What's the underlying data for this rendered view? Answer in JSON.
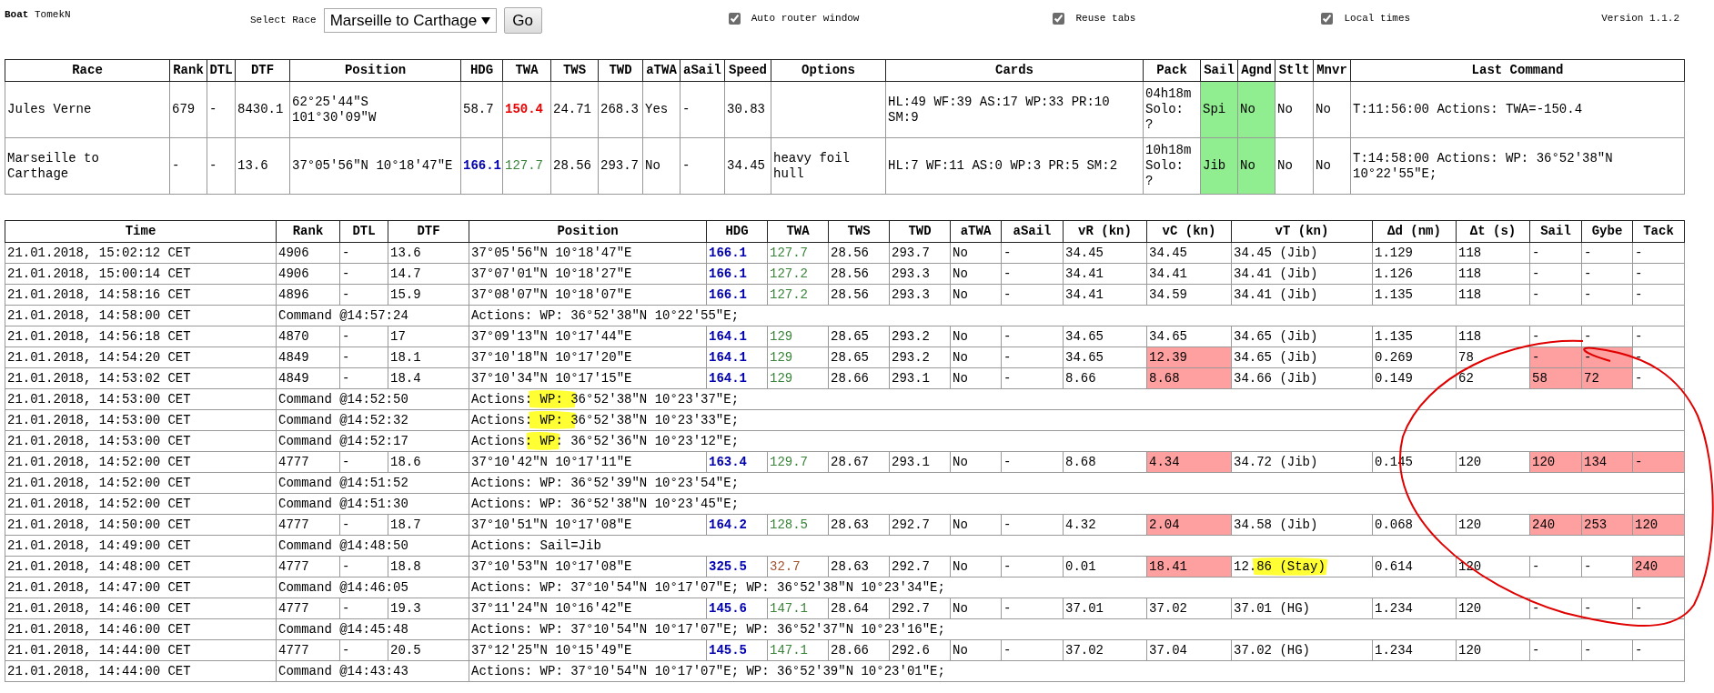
{
  "header": {
    "boat_label": "Boat",
    "boat_name": "TomekN",
    "race_select": {
      "label": "Select Race",
      "value": "Marseille to Carthage"
    },
    "go_button": "Go",
    "options": [
      {
        "label": "Auto router window",
        "checked": true
      },
      {
        "label": "Reuse tabs",
        "checked": true
      },
      {
        "label": "Local times",
        "checked": true
      }
    ],
    "version": "Version 1.1.2"
  },
  "races_columns": [
    "Race",
    "Rank",
    "DTL",
    "DTF",
    "Position",
    "HDG",
    "TWA",
    "TWS",
    "TWD",
    "aTWA",
    "aSail",
    "Speed",
    "Options",
    "Cards",
    "Pack",
    "Sail",
    "Agnd",
    "Stlt",
    "Mnvr",
    "Last Command"
  ],
  "races": [
    {
      "race": "Jules Verne",
      "rank": "679",
      "dtl": "-",
      "dtf": "8430.1",
      "position": "62°25'44\"S 101°30'09\"W",
      "hdg": {
        "text": "58.7",
        "color": "#000000",
        "bold": false
      },
      "twa": {
        "text": "150.4",
        "color": "#ee0000",
        "bold": true
      },
      "tws": "24.71",
      "twd": "268.3",
      "atwa": "Yes",
      "asail": "-",
      "speed": "30.83",
      "cards": "HL:49 WF:39 AS:17 WP:33 PR:10 SM:9",
      "pack": "04h18m Solo: ?",
      "sail": {
        "text": "Spi",
        "highlight": true
      },
      "agnd": {
        "text": "No",
        "highlight": true
      },
      "stlt": "No",
      "mnvr": "No",
      "last_command": "T:11:56:00 Actions: TWA=-150.4"
    },
    {
      "race": "Marseille to Carthage",
      "rank": "-",
      "dtl": "-",
      "dtf": "13.6",
      "position": "37°05'56\"N 10°18'47\"E",
      "hdg": {
        "text": "166.1",
        "color": "#0000b0",
        "bold": true
      },
      "twa": {
        "text": "127.7",
        "color": "#398439",
        "bold": false
      },
      "tws": "28.56",
      "twd": "293.7",
      "atwa": "No",
      "asail": "-",
      "speed": "34.45",
      "options": "heavy foil hull",
      "cards": "HL:7 WF:11 AS:0 WP:3 PR:5 SM:2",
      "pack": "10h18m Solo: ?",
      "sail": {
        "text": "Jib",
        "highlight": true
      },
      "agnd": {
        "text": "No",
        "highlight": true
      },
      "stlt": "No",
      "mnvr": "No",
      "last_command": "T:14:58:00 Actions: WP: 36°52'38\"N 10°22'55\"E;"
    }
  ],
  "log_columns": [
    "Time",
    "Rank",
    "DTL",
    "DTF",
    "Position",
    "HDG",
    "TWA",
    "TWS",
    "TWD",
    "aTWA",
    "aSail",
    "vR (kn)",
    "vC (kn)",
    "vT (kn)",
    "Δd (nm)",
    "Δt (s)",
    "Sail",
    "Gybe",
    "Tack"
  ],
  "log": [
    {
      "kind": "data",
      "time": "21.01.2018, 15:02:12 CET",
      "rank": "4906",
      "dtl": "-",
      "dtf": "13.6",
      "position": "37°05'56\"N 10°18'47\"E",
      "hdg": "166.1",
      "twa": {
        "text": "127.7",
        "color": "#398439"
      },
      "tws": "28.56",
      "twd": "293.7",
      "atwa": "No",
      "asail": "-",
      "vr": "34.45",
      "vc": {
        "text": "34.45",
        "alert": false
      },
      "vt": "34.45 (Jib)",
      "dd": "1.129",
      "dt": "118",
      "sail": {
        "text": "-",
        "alert": false
      },
      "gybe": {
        "text": "-",
        "alert": false
      },
      "tack": {
        "text": "-",
        "alert": false
      }
    },
    {
      "kind": "data",
      "time": "21.01.2018, 15:00:14 CET",
      "rank": "4906",
      "dtl": "-",
      "dtf": "14.7",
      "position": "37°07'01\"N 10°18'27\"E",
      "hdg": "166.1",
      "twa": {
        "text": "127.2",
        "color": "#398439"
      },
      "tws": "28.56",
      "twd": "293.3",
      "atwa": "No",
      "asail": "-",
      "vr": "34.41",
      "vc": {
        "text": "34.41",
        "alert": false
      },
      "vt": "34.41 (Jib)",
      "dd": "1.126",
      "dt": "118",
      "sail": {
        "text": "-",
        "alert": false
      },
      "gybe": {
        "text": "-",
        "alert": false
      },
      "tack": {
        "text": "-",
        "alert": false
      }
    },
    {
      "kind": "data",
      "time": "21.01.2018, 14:58:16 CET",
      "rank": "4896",
      "dtl": "-",
      "dtf": "15.9",
      "position": "37°08'07\"N 10°18'07\"E",
      "hdg": "166.1",
      "twa": {
        "text": "127.2",
        "color": "#398439"
      },
      "tws": "28.56",
      "twd": "293.3",
      "atwa": "No",
      "asail": "-",
      "vr": "34.41",
      "vc": {
        "text": "34.59",
        "alert": false
      },
      "vt": "34.41 (Jib)",
      "dd": "1.135",
      "dt": "118",
      "sail": {
        "text": "-",
        "alert": false
      },
      "gybe": {
        "text": "-",
        "alert": false
      },
      "tack": {
        "text": "-",
        "alert": false
      }
    },
    {
      "kind": "command",
      "time": "21.01.2018, 14:58:00 CET",
      "command": "Command @14:57:24",
      "actions": "Actions: WP: 36°52'38\"N 10°22'55\"E;"
    },
    {
      "kind": "data",
      "time": "21.01.2018, 14:56:18 CET",
      "rank": "4870",
      "dtl": "-",
      "dtf": "17",
      "position": "37°09'13\"N 10°17'44\"E",
      "hdg": "164.1",
      "twa": {
        "text": "129",
        "color": "#398439"
      },
      "tws": "28.65",
      "twd": "293.2",
      "atwa": "No",
      "asail": "-",
      "vr": "34.65",
      "vc": {
        "text": "34.65",
        "alert": false
      },
      "vt": "34.65 (Jib)",
      "dd": "1.135",
      "dt": "118",
      "sail": {
        "text": "-",
        "alert": false
      },
      "gybe": {
        "text": "-",
        "alert": false
      },
      "tack": {
        "text": "-",
        "alert": false
      }
    },
    {
      "kind": "data",
      "time": "21.01.2018, 14:54:20 CET",
      "rank": "4849",
      "dtl": "-",
      "dtf": "18.1",
      "position": "37°10'18\"N 10°17'20\"E",
      "hdg": "164.1",
      "twa": {
        "text": "129",
        "color": "#398439"
      },
      "tws": "28.65",
      "twd": "293.2",
      "atwa": "No",
      "asail": "-",
      "vr": "34.65",
      "vc": {
        "text": "12.39",
        "alert": true
      },
      "vt": "34.65 (Jib)",
      "dd": "0.269",
      "dt": "78",
      "sail": {
        "text": "-",
        "alert": true
      },
      "gybe": {
        "text": "-",
        "alert": true
      },
      "tack": {
        "text": "-",
        "alert": false
      }
    },
    {
      "kind": "data",
      "time": "21.01.2018, 14:53:02 CET",
      "rank": "4849",
      "dtl": "-",
      "dtf": "18.4",
      "position": "37°10'34\"N 10°17'15\"E",
      "hdg": "164.1",
      "twa": {
        "text": "129",
        "color": "#398439"
      },
      "tws": "28.66",
      "twd": "293.1",
      "atwa": "No",
      "asail": "-",
      "vr": "8.66",
      "vc": {
        "text": "8.68",
        "alert": true
      },
      "vt": "34.66 (Jib)",
      "dd": "0.149",
      "dt": "62",
      "sail": {
        "text": "58",
        "alert": true
      },
      "gybe": {
        "text": "72",
        "alert": true
      },
      "tack": {
        "text": "-",
        "alert": false
      }
    },
    {
      "kind": "command",
      "time": "21.01.2018, 14:53:00 CET",
      "command": "Command @14:52:50",
      "actions": "Actions: WP: 36°52'38\"N 10°23'37\"E;"
    },
    {
      "kind": "command",
      "time": "21.01.2018, 14:53:00 CET",
      "command": "Command @14:52:32",
      "actions": "Actions: WP: 36°52'38\"N 10°23'33\"E;"
    },
    {
      "kind": "command",
      "time": "21.01.2018, 14:53:00 CET",
      "command": "Command @14:52:17",
      "actions": "Actions: WP: 36°52'36\"N 10°23'12\"E;"
    },
    {
      "kind": "data",
      "time": "21.01.2018, 14:52:00 CET",
      "rank": "4777",
      "dtl": "-",
      "dtf": "18.6",
      "position": "37°10'42\"N 10°17'11\"E",
      "hdg": "163.4",
      "twa": {
        "text": "129.7",
        "color": "#398439"
      },
      "tws": "28.67",
      "twd": "293.1",
      "atwa": "No",
      "asail": "-",
      "vr": "8.68",
      "vc": {
        "text": "4.34",
        "alert": true
      },
      "vt": "34.72 (Jib)",
      "dd": "0.145",
      "dt": "120",
      "sail": {
        "text": "120",
        "alert": true
      },
      "gybe": {
        "text": "134",
        "alert": true
      },
      "tack": {
        "text": "-",
        "alert": true
      }
    },
    {
      "kind": "command",
      "time": "21.01.2018, 14:52:00 CET",
      "command": "Command @14:51:52",
      "actions": "Actions: WP: 36°52'39\"N 10°23'54\"E;"
    },
    {
      "kind": "command",
      "time": "21.01.2018, 14:52:00 CET",
      "command": "Command @14:51:30",
      "actions": "Actions: WP: 36°52'38\"N 10°23'45\"E;"
    },
    {
      "kind": "data",
      "time": "21.01.2018, 14:50:00 CET",
      "rank": "4777",
      "dtl": "-",
      "dtf": "18.7",
      "position": "37°10'51\"N 10°17'08\"E",
      "hdg": "164.2",
      "twa": {
        "text": "128.5",
        "color": "#398439"
      },
      "tws": "28.63",
      "twd": "292.7",
      "atwa": "No",
      "asail": "-",
      "vr": "4.32",
      "vc": {
        "text": "2.04",
        "alert": true
      },
      "vt": "34.58 (Jib)",
      "dd": "0.068",
      "dt": "120",
      "sail": {
        "text": "240",
        "alert": true
      },
      "gybe": {
        "text": "253",
        "alert": true
      },
      "tack": {
        "text": "120",
        "alert": true
      }
    },
    {
      "kind": "command",
      "time": "21.01.2018, 14:49:00 CET",
      "command": "Command @14:48:50",
      "actions": "Actions: Sail=Jib"
    },
    {
      "kind": "data",
      "time": "21.01.2018, 14:48:00 CET",
      "rank": "4777",
      "dtl": "-",
      "dtf": "18.8",
      "position": "37°10'53\"N 10°17'08\"E",
      "hdg": "325.5",
      "twa": {
        "text": "32.7",
        "color": "#a0522d"
      },
      "tws": "28.63",
      "twd": "292.7",
      "atwa": "No",
      "asail": "-",
      "vr": "0.01",
      "vc": {
        "text": "18.41",
        "alert": true
      },
      "vt": "12.86 (Stay)",
      "dd": "0.614",
      "dt": "120",
      "sail": {
        "text": "-",
        "alert": false
      },
      "gybe": {
        "text": "-",
        "alert": false
      },
      "tack": {
        "text": "240",
        "alert": true
      }
    },
    {
      "kind": "command",
      "time": "21.01.2018, 14:47:00 CET",
      "command": "Command @14:46:05",
      "actions": "Actions: WP: 37°10'54\"N 10°17'07\"E; WP: 36°52'38\"N 10°23'34\"E;"
    },
    {
      "kind": "data",
      "time": "21.01.2018, 14:46:00 CET",
      "rank": "4777",
      "dtl": "-",
      "dtf": "19.3",
      "position": "37°11'24\"N 10°16'42\"E",
      "hdg": "145.6",
      "twa": {
        "text": "147.1",
        "color": "#398439"
      },
      "tws": "28.64",
      "twd": "292.7",
      "atwa": "No",
      "asail": "-",
      "vr": "37.01",
      "vc": {
        "text": "37.02",
        "alert": false
      },
      "vt": "37.01 (HG)",
      "dd": "1.234",
      "dt": "120",
      "sail": {
        "text": "-",
        "alert": false
      },
      "gybe": {
        "text": "-",
        "alert": false
      },
      "tack": {
        "text": "-",
        "alert": false
      }
    },
    {
      "kind": "command",
      "time": "21.01.2018, 14:46:00 CET",
      "command": "Command @14:45:48",
      "actions": "Actions: WP: 37°10'54\"N 10°17'07\"E; WP: 36°52'37\"N 10°23'16\"E;"
    },
    {
      "kind": "data",
      "time": "21.01.2018, 14:44:00 CET",
      "rank": "4777",
      "dtl": "-",
      "dtf": "20.5",
      "position": "37°12'25\"N 10°15'49\"E",
      "hdg": "145.5",
      "twa": {
        "text": "147.1",
        "color": "#398439"
      },
      "tws": "28.66",
      "twd": "292.6",
      "atwa": "No",
      "asail": "-",
      "vr": "37.02",
      "vc": {
        "text": "37.04",
        "alert": false
      },
      "vt": "37.02 (HG)",
      "dd": "1.234",
      "dt": "120",
      "sail": {
        "text": "-",
        "alert": false
      },
      "gybe": {
        "text": "-",
        "alert": false
      },
      "tack": {
        "text": "-",
        "alert": false
      }
    },
    {
      "kind": "command",
      "time": "21.01.2018, 14:44:00 CET",
      "command": "Command @14:43:43",
      "actions": "Actions: WP: 37°10'54\"N 10°17'07\"E; WP: 36°52'39\"N 10°23'01\"E;"
    }
  ]
}
